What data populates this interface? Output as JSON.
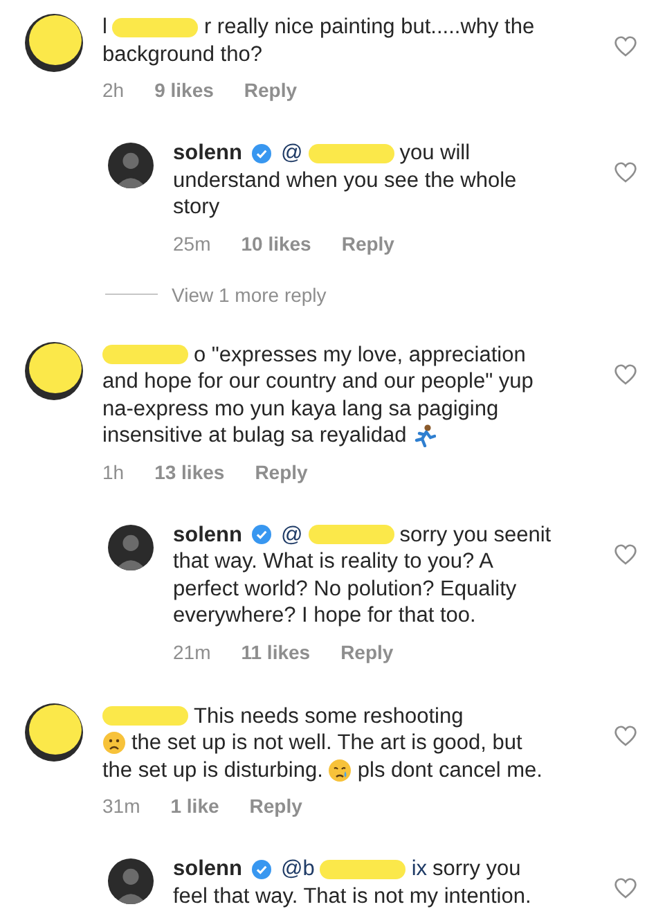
{
  "thread": [
    {
      "kind": "comment",
      "avatar_redacted": true,
      "lines": [
        [
          {
            "kind": "text",
            "text": "l"
          },
          {
            "kind": "redacted"
          },
          {
            "kind": "text",
            "text": "r really nice painting but.....why the"
          }
        ],
        [
          {
            "kind": "text",
            "text": "background tho?"
          }
        ]
      ],
      "time": "2h",
      "likes": "9 likes",
      "reply": "Reply",
      "liked": false
    },
    {
      "kind": "reply",
      "avatar_redacted": false,
      "lines": [
        [
          {
            "kind": "username",
            "text": "solenn"
          },
          {
            "kind": "verified"
          },
          {
            "kind": "mention",
            "text": "@"
          },
          {
            "kind": "redacted"
          },
          {
            "kind": "text",
            "text": "you will"
          }
        ],
        [
          {
            "kind": "text",
            "text": "understand when you see the whole"
          }
        ],
        [
          {
            "kind": "text",
            "text": "story"
          }
        ]
      ],
      "time": "25m",
      "likes": "10 likes",
      "reply": "Reply",
      "liked": false
    },
    {
      "kind": "view-more",
      "text": "View 1 more reply"
    },
    {
      "kind": "comment",
      "avatar_redacted": true,
      "lines": [
        [
          {
            "kind": "redacted"
          },
          {
            "kind": "text",
            "text": "o \"expresses my love, appreciation"
          }
        ],
        [
          {
            "kind": "text",
            "text": "and hope for our country and our people\" yup"
          }
        ],
        [
          {
            "kind": "text",
            "text": "na-express mo yun kaya lang sa pagiging"
          }
        ],
        [
          {
            "kind": "text",
            "text": "insensitive at bulag sa reyalidad"
          },
          {
            "kind": "emoji-runner"
          }
        ]
      ],
      "time": "1h",
      "likes": "13 likes",
      "reply": "Reply",
      "liked": false
    },
    {
      "kind": "reply",
      "avatar_redacted": false,
      "lines": [
        [
          {
            "kind": "username",
            "text": "solenn"
          },
          {
            "kind": "verified"
          },
          {
            "kind": "mention",
            "text": "@"
          },
          {
            "kind": "redacted"
          },
          {
            "kind": "text",
            "text": "sorry you seenit"
          }
        ],
        [
          {
            "kind": "text",
            "text": "that way. What is reality to you? A"
          }
        ],
        [
          {
            "kind": "text",
            "text": "perfect world? No polution? Equality"
          }
        ],
        [
          {
            "kind": "text",
            "text": "everywhere?  I hope for that too."
          }
        ]
      ],
      "time": "21m",
      "likes": "11 likes",
      "reply": "Reply",
      "liked": false
    },
    {
      "kind": "comment",
      "avatar_redacted": true,
      "lines": [
        [
          {
            "kind": "redacted"
          },
          {
            "kind": "text",
            "text": "This needs some reshooting"
          }
        ],
        [
          {
            "kind": "emoji-frown"
          },
          {
            "kind": "text",
            "text": "the set up is not well. The art is good, but"
          }
        ],
        [
          {
            "kind": "text",
            "text": "the set up is disturbing."
          },
          {
            "kind": "emoji-crying"
          },
          {
            "kind": "text",
            "text": "pls dont cancel me."
          }
        ]
      ],
      "time": "31m",
      "likes": "1 like",
      "reply": "Reply",
      "liked": false
    },
    {
      "kind": "reply",
      "avatar_redacted": false,
      "lines": [
        [
          {
            "kind": "username",
            "text": "solenn"
          },
          {
            "kind": "verified"
          },
          {
            "kind": "mention",
            "text": "@b"
          },
          {
            "kind": "redacted"
          },
          {
            "kind": "mention",
            "text": "ix"
          },
          {
            "kind": "text",
            "text": "sorry you"
          }
        ],
        [
          {
            "kind": "text",
            "text": "feel that way. That is not my intention."
          }
        ]
      ],
      "liked": false
    }
  ]
}
